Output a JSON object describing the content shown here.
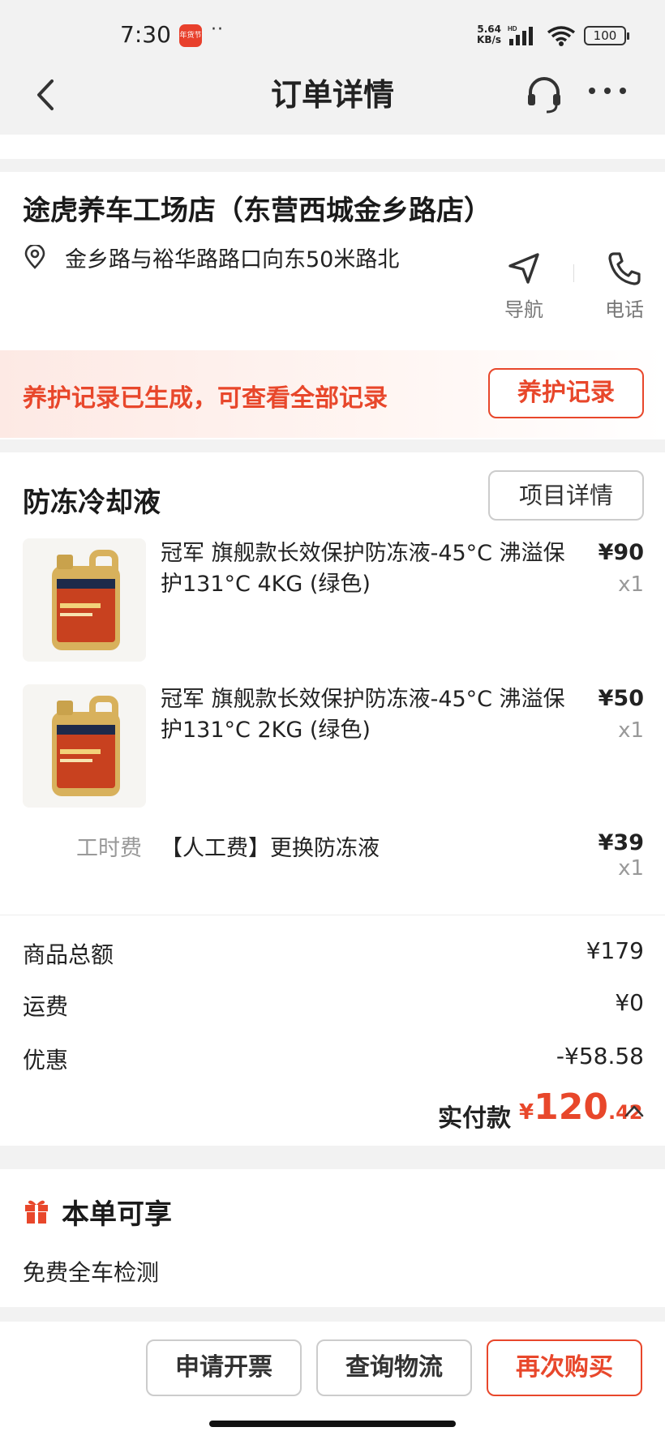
{
  "status": {
    "time": "7:30",
    "app_badge": "年货节",
    "dots": "··",
    "net_speed_value": "5.64",
    "net_speed_unit": "KB/s",
    "battery": "100"
  },
  "nav": {
    "title": "订单详情"
  },
  "store": {
    "name": "途虎养车工场店（东营西城金乡路店）",
    "address": "金乡路与裕华路路口向东50米路北",
    "nav_label": "导航",
    "phone_label": "电话"
  },
  "notice": {
    "text": "养护记录已生成，可查看全部记录",
    "button": "养护记录"
  },
  "section": {
    "title": "防冻冷却液",
    "detail_button": "项目详情"
  },
  "items": [
    {
      "name": "冠军 旗舰款长效保护防冻液-45°C 沸溢保护131°C 4KG (绿色)",
      "price": "¥90",
      "qty": "x1"
    },
    {
      "name": "冠军 旗舰款长效保护防冻液-45°C 沸溢保护131°C 2KG (绿色)",
      "price": "¥50",
      "qty": "x1"
    }
  ],
  "labor": {
    "tag": "工时费",
    "name": "【人工费】更换防冻液",
    "price": "¥39",
    "qty": "x1"
  },
  "summary": {
    "goods_label": "商品总额",
    "goods_value": "¥179",
    "shipping_label": "运费",
    "shipping_value": "¥0",
    "discount_label": "优惠",
    "discount_value": "-¥58.58",
    "paid_label": "实付款",
    "paid_currency": "¥",
    "paid_int": "120",
    "paid_dec": ".42"
  },
  "benefit": {
    "title": "本单可享",
    "item": "免费全车检测"
  },
  "actions": {
    "invoice": "申请开票",
    "logistics": "查询物流",
    "rebuy": "再次购买"
  },
  "colors": {
    "accent": "#e8472b",
    "background": "#f2f2f2"
  }
}
